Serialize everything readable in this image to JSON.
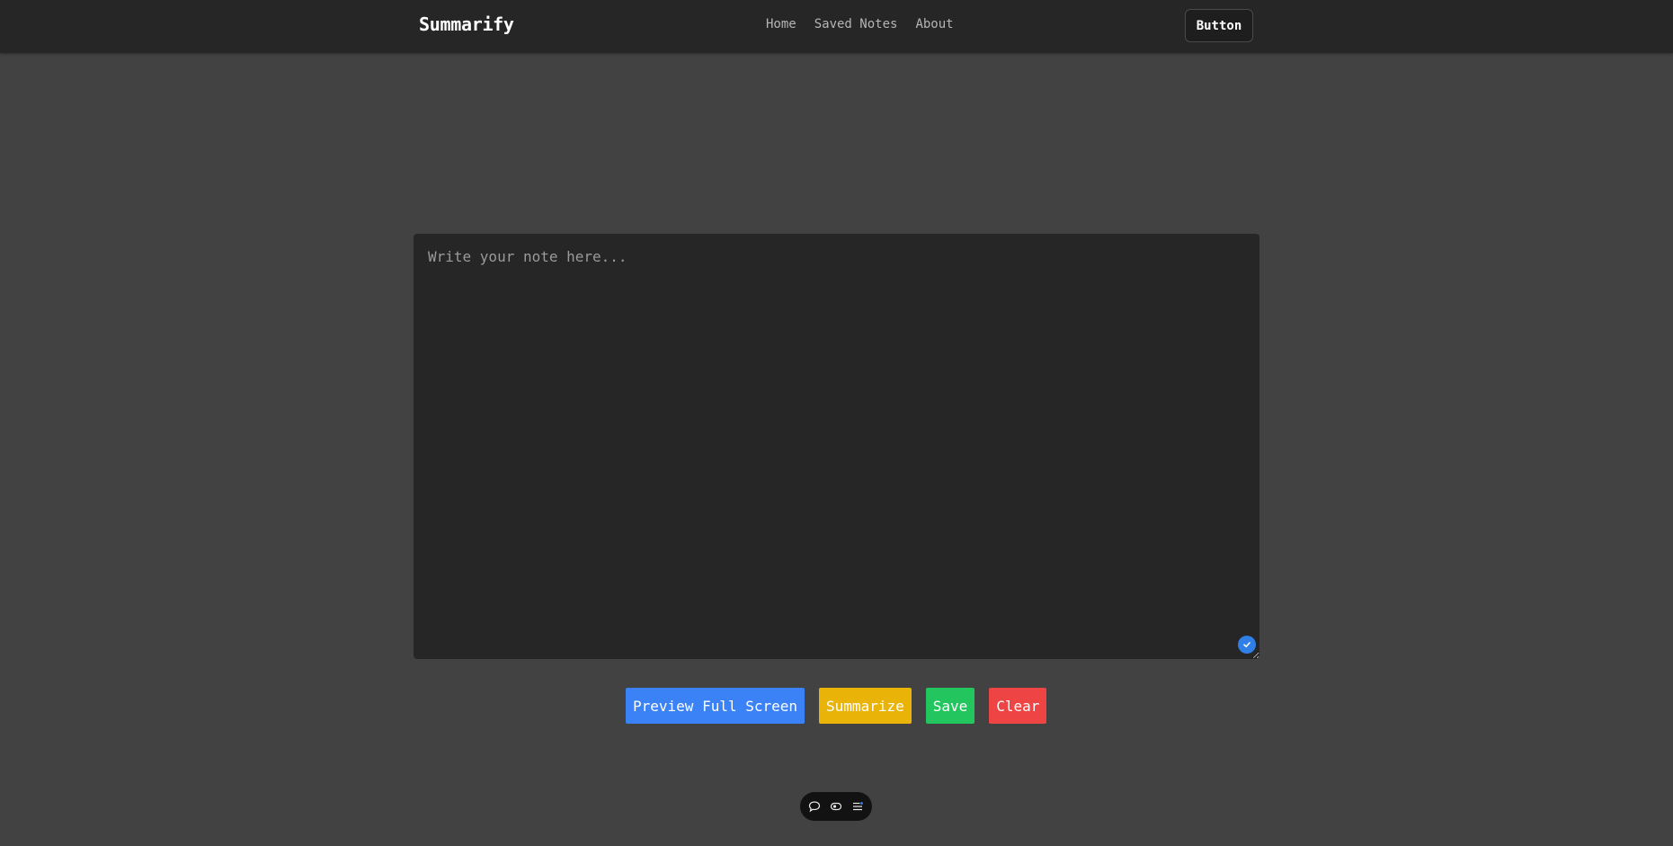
{
  "header": {
    "brand": "Summarify",
    "nav": [
      {
        "label": "Home"
      },
      {
        "label": "Saved Notes"
      },
      {
        "label": "About"
      }
    ],
    "button_label": "Button"
  },
  "editor": {
    "placeholder": "Write your note here...",
    "value": "",
    "status_icon": "check-circle-icon"
  },
  "actions": {
    "preview_label": "Preview Full Screen",
    "summarize_label": "Summarize",
    "save_label": "Save",
    "clear_label": "Clear"
  },
  "floating_toolbar": {
    "icons": [
      "chat-bubble-icon",
      "eye-toggle-icon",
      "list-settings-icon"
    ]
  },
  "colors": {
    "background": "#424242",
    "navbar": "#262626",
    "preview": "#3b82f6",
    "summarize": "#eab308",
    "save": "#22c55e",
    "clear": "#ef4444",
    "check": "#2f7fe6"
  }
}
